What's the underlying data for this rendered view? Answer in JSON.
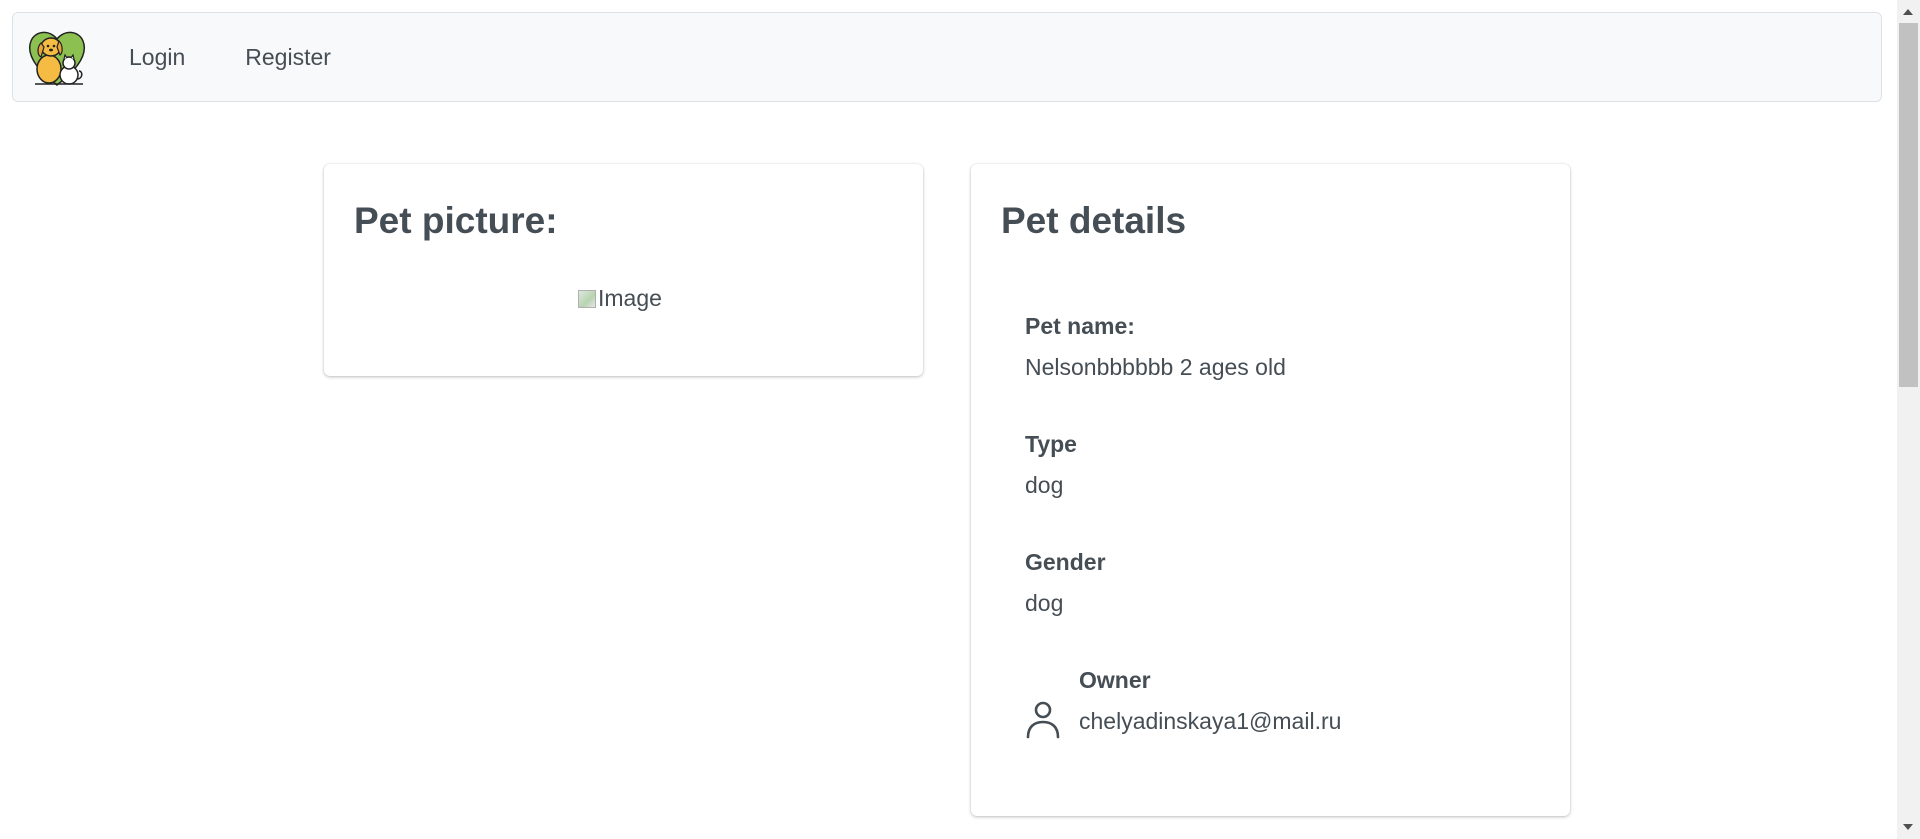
{
  "navbar": {
    "logo_icon": "dog-and-cat-heart-logo",
    "login_label": "Login",
    "register_label": "Register"
  },
  "picture_card": {
    "title": "Pet picture:",
    "image_alt": "Image"
  },
  "details_card": {
    "title": "Pet details",
    "name_label": "Pet name:",
    "name_value": "Nelsonbbbbbb 2 ages old",
    "type_label": "Type",
    "type_value": "dog",
    "gender_label": "Gender",
    "gender_value": "dog",
    "owner_icon": "user-icon",
    "owner_label": "Owner",
    "owner_value": "chelyadinskaya1@mail.ru"
  },
  "colors": {
    "navbar_bg": "#f8f9fa",
    "text": "#454d55",
    "logo_green": "#8cc152",
    "logo_yellow": "#f6bb42"
  }
}
